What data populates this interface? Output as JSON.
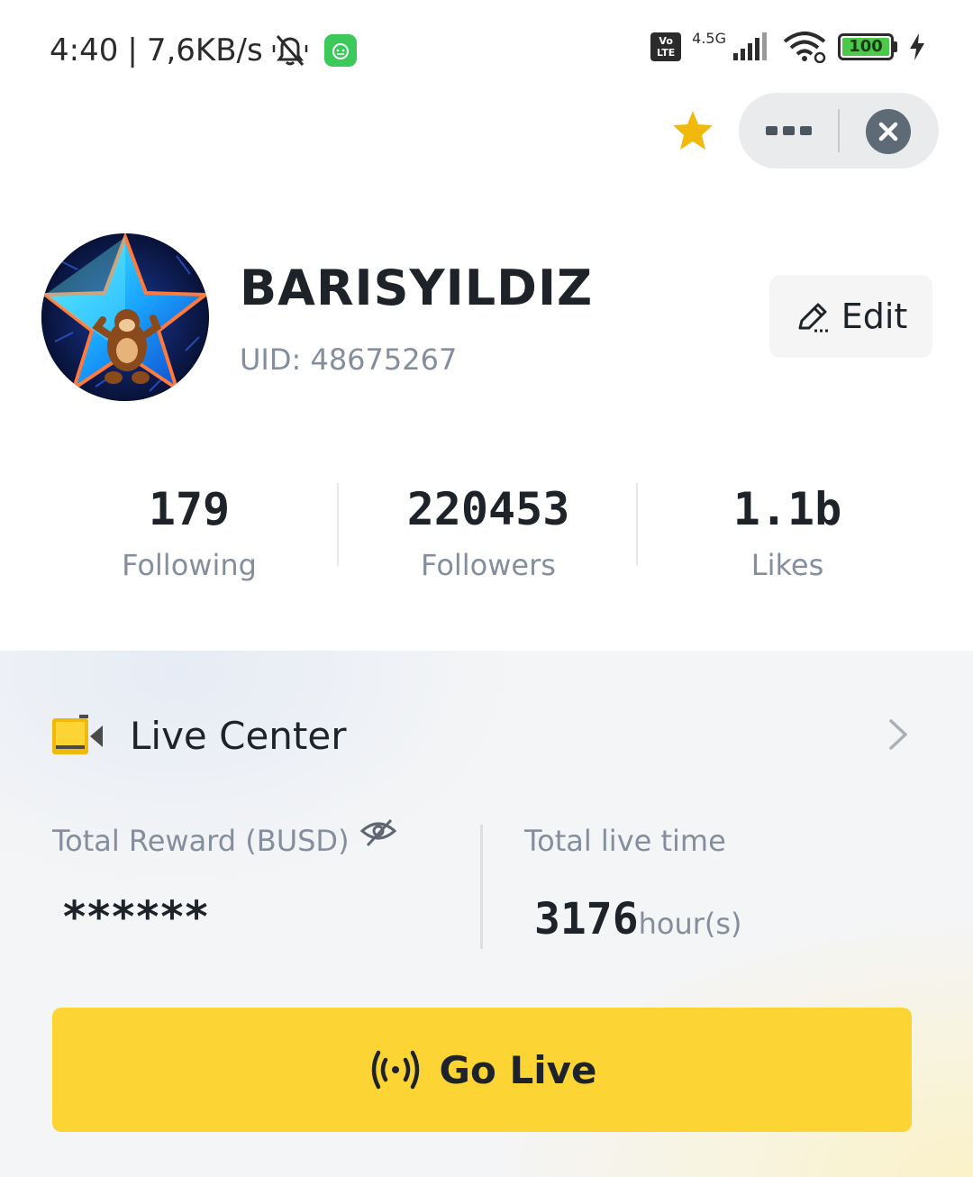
{
  "status_bar": {
    "time": "4:40",
    "separator": "|",
    "speed": "7,6KB/s",
    "network": "4.5G",
    "battery": "100"
  },
  "profile": {
    "username": "BARISYILDIZ",
    "uid": "UID: 48675267",
    "edit_label": "Edit"
  },
  "stats": [
    {
      "value": "179",
      "label": "Following"
    },
    {
      "value": "220453",
      "label": "Followers"
    },
    {
      "value": "1.1b",
      "label": "Likes"
    }
  ],
  "live_center": {
    "title": "Live Center",
    "reward_label": "Total Reward (BUSD)",
    "reward_value": "******",
    "time_label": "Total live time",
    "time_value": "3176",
    "time_unit": "hour(s)",
    "go_live_label": "Go Live"
  },
  "colors": {
    "accent_yellow": "#fcd535",
    "text_primary": "#1e2329",
    "text_secondary": "#848e9c"
  }
}
